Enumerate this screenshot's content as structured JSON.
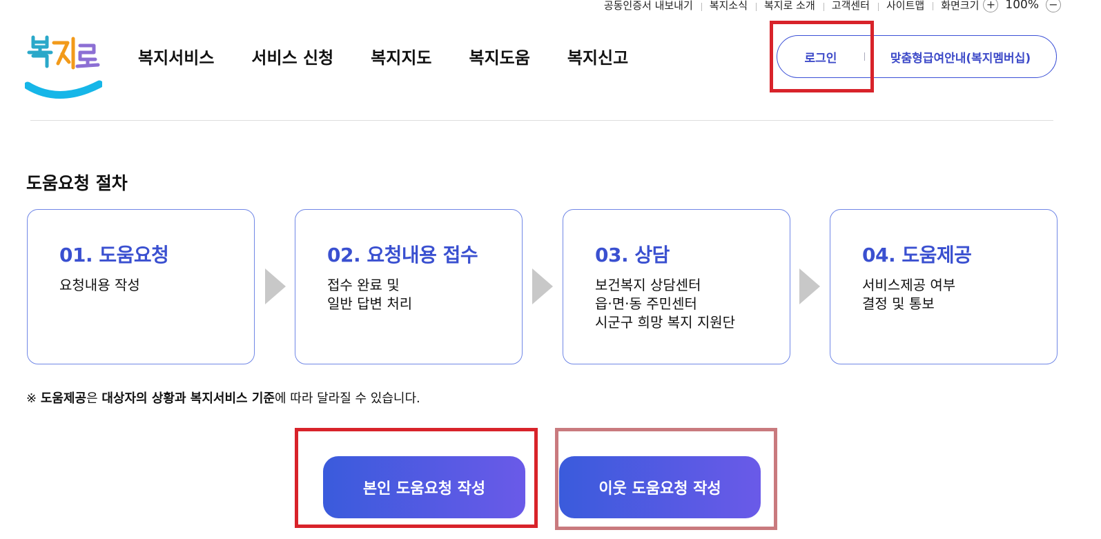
{
  "util_bar": {
    "links": [
      "공동인증서 내보내기",
      "복지소식",
      "복지로 소개",
      "고객센터",
      "사이트맵"
    ],
    "zoom_label": "화면크기",
    "zoom_plus": "+",
    "zoom_value": "100%",
    "zoom_minus": "−"
  },
  "logo": {
    "text": "복지로",
    "icon": "bokjiro-logo-icon"
  },
  "gnb": [
    "복지서비스",
    "서비스 신청",
    "복지지도",
    "복지도움",
    "복지신고"
  ],
  "member": {
    "login": "로그인",
    "guide": "맞춤형급여안내(복지멤버십)"
  },
  "procedure": {
    "title": "도움요청 절차",
    "steps": [
      {
        "title": "01. 도움요청",
        "desc": [
          "요청내용 작성"
        ]
      },
      {
        "title": "02. 요청내용 접수",
        "desc": [
          "접수 완료 및",
          "일반 답변 처리"
        ]
      },
      {
        "title": "03. 상담",
        "desc": [
          "보건복지 상담센터",
          "읍·면·동 주민센터",
          "시군구 희망 복지 지원단"
        ]
      },
      {
        "title": "04. 도움제공",
        "desc": [
          "서비스제공 여부",
          "결정 및 통보"
        ]
      }
    ]
  },
  "notice": {
    "prefix": "※ ",
    "bold1": "도움제공",
    "mid1": "은 ",
    "bold2": "대상자의 상황과 복지서비스 기준",
    "suffix": "에 따라 달라질 수 있습니다."
  },
  "actions": {
    "self": "본인 도움요청 작성",
    "neighbor": "이웃 도움요청 작성"
  },
  "colors": {
    "accent": "#3a50d0",
    "button_gradient_start": "#3a5bdc",
    "button_gradient_end": "#6a5ae8",
    "highlight_red": "#d8232a",
    "highlight_muted": "#c97a7e"
  }
}
